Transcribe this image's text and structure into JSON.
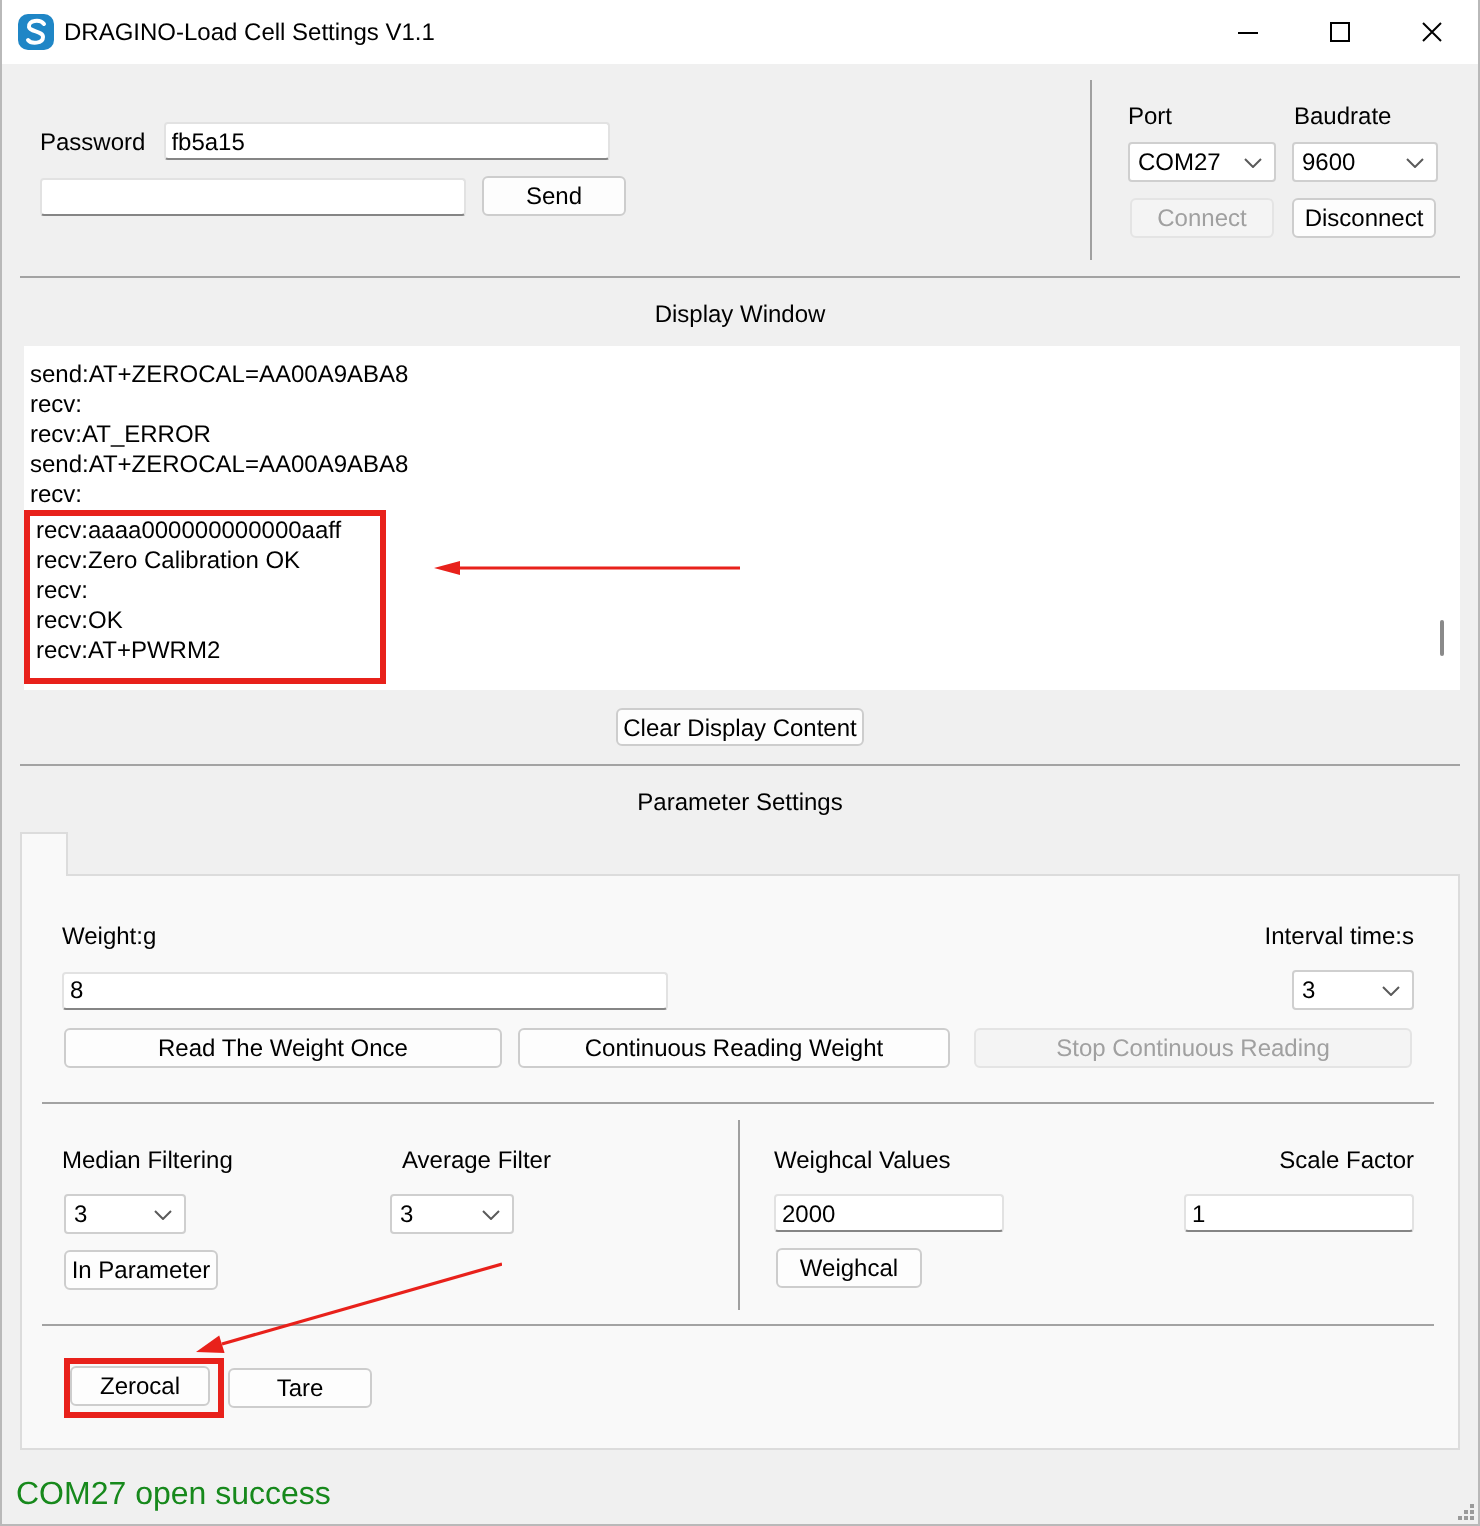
{
  "window": {
    "title": "DRAGINO-Load Cell Settings V1.1"
  },
  "connection": {
    "password_label": "Password",
    "password": "fb5a15",
    "send_button": "Send",
    "port_label": "Port",
    "port": "COM27",
    "baudrate_label": "Baudrate",
    "baudrate": "9600",
    "buttons": [
      {
        "label": "Connect",
        "disabled": true
      },
      {
        "label": "Disconnect",
        "disabled": false
      }
    ]
  },
  "display": {
    "title": "Display Window",
    "lines": [
      {
        "text": "send:AT+ZEROCAL=AA00A9ABA8",
        "highlighted": false
      },
      {
        "text": "recv:",
        "highlighted": false
      },
      {
        "text": "recv:AT_ERROR",
        "highlighted": false
      },
      {
        "text": "send:AT+ZEROCAL=AA00A9ABA8",
        "highlighted": false
      },
      {
        "text": "recv:",
        "highlighted": false
      },
      {
        "text": "recv:aaaa000000000000aaff",
        "highlighted": true
      },
      {
        "text": "recv:Zero Calibration OK",
        "highlighted": true
      },
      {
        "text": "recv:",
        "highlighted": true
      },
      {
        "text": "recv:OK",
        "highlighted": true
      },
      {
        "text": "recv:AT+PWRM2",
        "highlighted": true
      }
    ],
    "clear_button": "Clear Display Content"
  },
  "parameters": {
    "title": "Parameter Settings",
    "weight_label": "Weight:g",
    "weight": "8",
    "interval_label": "Interval time:s",
    "interval": "3",
    "read_buttons": [
      {
        "label": "Read The Weight Once",
        "disabled": false
      },
      {
        "label": "Continuous Reading Weight",
        "disabled": false
      },
      {
        "label": "Stop Continuous Reading",
        "disabled": true
      }
    ],
    "filters": [
      {
        "label": "Median Filtering",
        "value": "3"
      },
      {
        "label": "Average Filter",
        "value": "3"
      }
    ],
    "in_parameter_button": "In Parameter",
    "weighcal_label": "Weighcal Values",
    "weighcal_value": "2000",
    "weighcal_button": "Weighcal",
    "scale_factor_label": "Scale Factor",
    "scale_factor": "1",
    "calibration_buttons": [
      {
        "label": "Zerocal",
        "highlighted": true
      },
      {
        "label": "Tare",
        "highlighted": false
      }
    ]
  },
  "status_bar": {
    "text": "COM27 open success"
  }
}
